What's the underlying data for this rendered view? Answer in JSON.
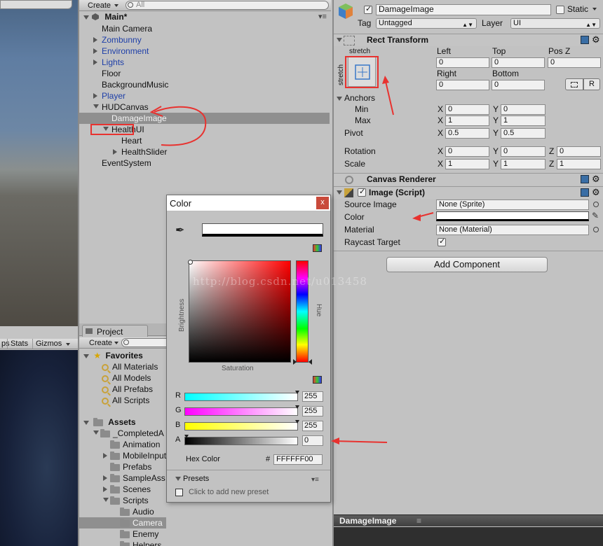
{
  "hierarchy": {
    "create_label": "Create",
    "search_placeholder": "All",
    "scene_name": "Main*",
    "items": [
      {
        "label": "Main Camera",
        "indent": 1,
        "fold": "none",
        "blue": false
      },
      {
        "label": "Zombunny",
        "indent": 1,
        "fold": "right",
        "blue": true
      },
      {
        "label": "Environment",
        "indent": 1,
        "fold": "right",
        "blue": true
      },
      {
        "label": "Lights",
        "indent": 1,
        "fold": "right",
        "blue": true
      },
      {
        "label": "Floor",
        "indent": 1,
        "fold": "none",
        "blue": false
      },
      {
        "label": "BackgroundMusic",
        "indent": 1,
        "fold": "none",
        "blue": false
      },
      {
        "label": "Player",
        "indent": 1,
        "fold": "right",
        "blue": true
      },
      {
        "label": "HUDCanvas",
        "indent": 1,
        "fold": "down",
        "blue": false
      },
      {
        "label": "DamageImage",
        "indent": 2,
        "fold": "none",
        "blue": false,
        "selected": true
      },
      {
        "label": "HealthUI",
        "indent": 2,
        "fold": "down",
        "blue": false
      },
      {
        "label": "Heart",
        "indent": 3,
        "fold": "none",
        "blue": false
      },
      {
        "label": "HealthSlider",
        "indent": 3,
        "fold": "right",
        "blue": false
      },
      {
        "label": "EventSystem",
        "indent": 1,
        "fold": "none",
        "blue": false
      }
    ]
  },
  "scene_toolbar": {
    "stats_label": "Stats",
    "gizmos_label": "Gizmos"
  },
  "project": {
    "tab_label": "Project",
    "create_label": "Create",
    "favorites_label": "Favorites",
    "favorites": [
      "All Materials",
      "All Models",
      "All Prefabs",
      "All Scripts"
    ],
    "assets_label": "Assets",
    "tree": [
      {
        "label": "_CompletedA",
        "indent": 1,
        "fold": "down"
      },
      {
        "label": "Animation",
        "indent": 2,
        "fold": "none"
      },
      {
        "label": "MobileInput",
        "indent": 2,
        "fold": "right"
      },
      {
        "label": "Prefabs",
        "indent": 2,
        "fold": "none"
      },
      {
        "label": "SampleAss",
        "indent": 2,
        "fold": "right"
      },
      {
        "label": "Scenes",
        "indent": 2,
        "fold": "right"
      },
      {
        "label": "Scripts",
        "indent": 2,
        "fold": "down"
      },
      {
        "label": "Audio",
        "indent": 3,
        "fold": "none"
      },
      {
        "label": "Camera",
        "indent": 3,
        "fold": "none",
        "selected": true
      },
      {
        "label": "Enemy",
        "indent": 3,
        "fold": "none"
      },
      {
        "label": "Helpers",
        "indent": 3,
        "fold": "none"
      }
    ]
  },
  "color_picker": {
    "title": "Color",
    "brightness_label": "Brightness",
    "hue_label": "Hue",
    "saturation_label": "Saturation",
    "channels": [
      {
        "name": "R",
        "value": "255"
      },
      {
        "name": "G",
        "value": "255"
      },
      {
        "name": "B",
        "value": "255"
      },
      {
        "name": "A",
        "value": "0"
      }
    ],
    "hex_label": "Hex Color",
    "hex_prefix": "#",
    "hex_value": "FFFFFF00",
    "presets_label": "Presets",
    "add_preset_label": "Click to add new preset",
    "close_label": "x",
    "watermark": "http://blog.csdn.net/u013458"
  },
  "inspector": {
    "object_name": "DamageImage",
    "static_label": "Static",
    "tag_label": "Tag",
    "tag_value": "Untagged",
    "layer_label": "Layer",
    "layer_value": "UI",
    "rect_transform": {
      "title": "Rect Transform",
      "stretch_h": "stretch",
      "stretch_v": "stretch",
      "left_label": "Left",
      "left_value": "0",
      "top_label": "Top",
      "top_value": "0",
      "posz_label": "Pos Z",
      "posz_value": "0",
      "right_label": "Right",
      "right_value": "0",
      "bottom_label": "Bottom",
      "bottom_value": "0",
      "r_button": "R",
      "anchors_label": "Anchors",
      "min_label": "Min",
      "min_x": "0",
      "min_y": "0",
      "max_label": "Max",
      "max_x": "1",
      "max_y": "1",
      "pivot_label": "Pivot",
      "pivot_x": "0.5",
      "pivot_y": "0.5",
      "rotation_label": "Rotation",
      "rot_x": "0",
      "rot_y": "0",
      "rot_z": "0",
      "scale_label": "Scale",
      "scale_x": "1",
      "scale_y": "1",
      "scale_z": "1",
      "x": "X",
      "y": "Y",
      "z": "Z"
    },
    "canvas_renderer_title": "Canvas Renderer",
    "image": {
      "title": "Image (Script)",
      "source_label": "Source Image",
      "source_value": "None (Sprite)",
      "color_label": "Color",
      "material_label": "Material",
      "material_value": "None (Material)",
      "raycast_label": "Raycast Target"
    },
    "add_component_label": "Add Component",
    "footer_title": "DamageImage"
  },
  "colors": {
    "annotation_red": "#e8322f",
    "selection_grey": "#8f8f8f"
  }
}
